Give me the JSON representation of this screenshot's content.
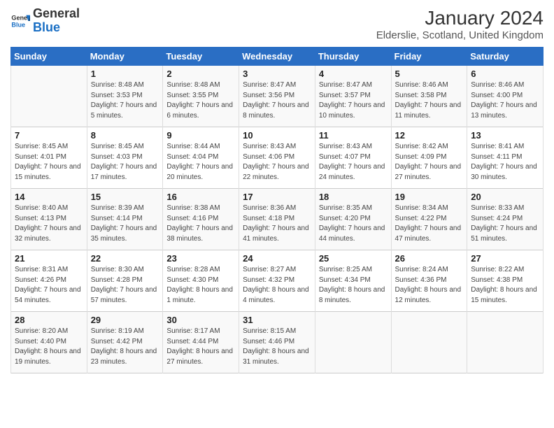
{
  "header": {
    "logo_general": "General",
    "logo_blue": "Blue",
    "month": "January 2024",
    "location": "Elderslie, Scotland, United Kingdom"
  },
  "weekdays": [
    "Sunday",
    "Monday",
    "Tuesday",
    "Wednesday",
    "Thursday",
    "Friday",
    "Saturday"
  ],
  "weeks": [
    [
      null,
      {
        "day": 1,
        "sunrise": "8:48 AM",
        "sunset": "3:53 PM",
        "daylight": "7 hours and 5 minutes."
      },
      {
        "day": 2,
        "sunrise": "8:48 AM",
        "sunset": "3:55 PM",
        "daylight": "7 hours and 6 minutes."
      },
      {
        "day": 3,
        "sunrise": "8:47 AM",
        "sunset": "3:56 PM",
        "daylight": "7 hours and 8 minutes."
      },
      {
        "day": 4,
        "sunrise": "8:47 AM",
        "sunset": "3:57 PM",
        "daylight": "7 hours and 10 minutes."
      },
      {
        "day": 5,
        "sunrise": "8:46 AM",
        "sunset": "3:58 PM",
        "daylight": "7 hours and 11 minutes."
      },
      {
        "day": 6,
        "sunrise": "8:46 AM",
        "sunset": "4:00 PM",
        "daylight": "7 hours and 13 minutes."
      }
    ],
    [
      {
        "day": 7,
        "sunrise": "8:45 AM",
        "sunset": "4:01 PM",
        "daylight": "7 hours and 15 minutes."
      },
      {
        "day": 8,
        "sunrise": "8:45 AM",
        "sunset": "4:03 PM",
        "daylight": "7 hours and 17 minutes."
      },
      {
        "day": 9,
        "sunrise": "8:44 AM",
        "sunset": "4:04 PM",
        "daylight": "7 hours and 20 minutes."
      },
      {
        "day": 10,
        "sunrise": "8:43 AM",
        "sunset": "4:06 PM",
        "daylight": "7 hours and 22 minutes."
      },
      {
        "day": 11,
        "sunrise": "8:43 AM",
        "sunset": "4:07 PM",
        "daylight": "7 hours and 24 minutes."
      },
      {
        "day": 12,
        "sunrise": "8:42 AM",
        "sunset": "4:09 PM",
        "daylight": "7 hours and 27 minutes."
      },
      {
        "day": 13,
        "sunrise": "8:41 AM",
        "sunset": "4:11 PM",
        "daylight": "7 hours and 30 minutes."
      }
    ],
    [
      {
        "day": 14,
        "sunrise": "8:40 AM",
        "sunset": "4:13 PM",
        "daylight": "7 hours and 32 minutes."
      },
      {
        "day": 15,
        "sunrise": "8:39 AM",
        "sunset": "4:14 PM",
        "daylight": "7 hours and 35 minutes."
      },
      {
        "day": 16,
        "sunrise": "8:38 AM",
        "sunset": "4:16 PM",
        "daylight": "7 hours and 38 minutes."
      },
      {
        "day": 17,
        "sunrise": "8:36 AM",
        "sunset": "4:18 PM",
        "daylight": "7 hours and 41 minutes."
      },
      {
        "day": 18,
        "sunrise": "8:35 AM",
        "sunset": "4:20 PM",
        "daylight": "7 hours and 44 minutes."
      },
      {
        "day": 19,
        "sunrise": "8:34 AM",
        "sunset": "4:22 PM",
        "daylight": "7 hours and 47 minutes."
      },
      {
        "day": 20,
        "sunrise": "8:33 AM",
        "sunset": "4:24 PM",
        "daylight": "7 hours and 51 minutes."
      }
    ],
    [
      {
        "day": 21,
        "sunrise": "8:31 AM",
        "sunset": "4:26 PM",
        "daylight": "7 hours and 54 minutes."
      },
      {
        "day": 22,
        "sunrise": "8:30 AM",
        "sunset": "4:28 PM",
        "daylight": "7 hours and 57 minutes."
      },
      {
        "day": 23,
        "sunrise": "8:28 AM",
        "sunset": "4:30 PM",
        "daylight": "8 hours and 1 minute."
      },
      {
        "day": 24,
        "sunrise": "8:27 AM",
        "sunset": "4:32 PM",
        "daylight": "8 hours and 4 minutes."
      },
      {
        "day": 25,
        "sunrise": "8:25 AM",
        "sunset": "4:34 PM",
        "daylight": "8 hours and 8 minutes."
      },
      {
        "day": 26,
        "sunrise": "8:24 AM",
        "sunset": "4:36 PM",
        "daylight": "8 hours and 12 minutes."
      },
      {
        "day": 27,
        "sunrise": "8:22 AM",
        "sunset": "4:38 PM",
        "daylight": "8 hours and 15 minutes."
      }
    ],
    [
      {
        "day": 28,
        "sunrise": "8:20 AM",
        "sunset": "4:40 PM",
        "daylight": "8 hours and 19 minutes."
      },
      {
        "day": 29,
        "sunrise": "8:19 AM",
        "sunset": "4:42 PM",
        "daylight": "8 hours and 23 minutes."
      },
      {
        "day": 30,
        "sunrise": "8:17 AM",
        "sunset": "4:44 PM",
        "daylight": "8 hours and 27 minutes."
      },
      {
        "day": 31,
        "sunrise": "8:15 AM",
        "sunset": "4:46 PM",
        "daylight": "8 hours and 31 minutes."
      },
      null,
      null,
      null
    ]
  ]
}
